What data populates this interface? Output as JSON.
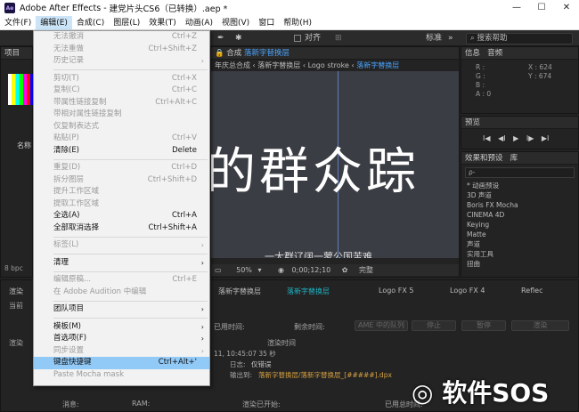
{
  "window": {
    "app": "Adobe After Effects",
    "file": "建党片头CS6（已转换）.aep *",
    "logo": "Ae",
    "min": "—",
    "max": "☐",
    "close": "✕"
  },
  "menubar": [
    "文件(F)",
    "编辑(E)",
    "合成(C)",
    "图层(L)",
    "效果(T)",
    "动画(A)",
    "视图(V)",
    "窗口",
    "帮助(H)"
  ],
  "toolbar": {
    "snap": "对齐",
    "workspace": "标准",
    "search_placeholder": "搜索帮助"
  },
  "project": {
    "title": "项目",
    "name_col": "名称",
    "bpc": "8 bpc"
  },
  "composition": {
    "title": "合成",
    "tab_name": "落新字替换层",
    "breadcrumbs": [
      "字库",
      "年庆总合成",
      "落新字替换层",
      "Logo stroke",
      "落新字替换层"
    ],
    "big_text": "的群众踪",
    "zoom": "50%",
    "timecode": "0;00;12;10",
    "quality": "完整",
    "sub_text": "一大群辽阔一蒙公国苦难"
  },
  "info": {
    "title": "信息",
    "audio": "音频",
    "r": "R :",
    "g": "G :",
    "b": "B :",
    "a": "A : 0",
    "x": "X : 624",
    "y": "Y : 674"
  },
  "preview": {
    "title": "预览",
    "controls": [
      "I◀",
      "◀I",
      "▶",
      "I▶",
      "▶I"
    ]
  },
  "effects": {
    "title": "效果和预设",
    "tab2": "库",
    "search": "ρ-",
    "items": [
      "* 动画预设",
      "3D 声道",
      "Boris FX Mocha",
      "CINEMA 4D",
      "Keying",
      "Matte",
      "声道",
      "实用工具",
      "扭曲"
    ]
  },
  "render_queue": {
    "tabs": [
      "渲染",
      "落新字替换层",
      "落新字替换层",
      "Logo FX 5",
      "Logo FX 4",
      "Reflec"
    ],
    "current": "当前",
    "render_label": "渲染",
    "elapsed": "已用时间:",
    "remaining": "剩余时间:",
    "ame": "AME 中的队列",
    "stop": "停止",
    "pause": "暂停",
    "render": "渲染",
    "status_col": "渲染时间",
    "row_time": "11, 10:45:07    35 秒",
    "log_label": "日志:",
    "log_value": "仅错误",
    "output_label": "输出到:",
    "output_value": "落新字替换层/落新字替换层_[#####].dpx",
    "msg": "消息:",
    "ram": "RAM:",
    "started": "渲染已开始:",
    "total": "已用总时间:"
  },
  "edit_menu": [
    {
      "label": "无法撤消",
      "sc": "Ctrl+Z",
      "dis": true
    },
    {
      "label": "无法重做",
      "sc": "Ctrl+Shift+Z",
      "dis": true
    },
    {
      "label": "历史记录",
      "sc": "",
      "dis": true,
      "sub": true
    },
    {
      "sep": true
    },
    {
      "label": "剪切(T)",
      "sc": "Ctrl+X",
      "dis": true
    },
    {
      "label": "复制(C)",
      "sc": "Ctrl+C",
      "dis": true
    },
    {
      "label": "带属性链接复制",
      "sc": "Ctrl+Alt+C",
      "dis": true
    },
    {
      "label": "带相对属性链接复制",
      "sc": "",
      "dis": true
    },
    {
      "label": "仅复制表达式",
      "sc": "",
      "dis": true
    },
    {
      "label": "粘贴(P)",
      "sc": "Ctrl+V",
      "dis": true
    },
    {
      "label": "清除(E)",
      "sc": "Delete",
      "dis": false
    },
    {
      "sep": true
    },
    {
      "label": "重复(D)",
      "sc": "Ctrl+D",
      "dis": true
    },
    {
      "label": "拆分图层",
      "sc": "Ctrl+Shift+D",
      "dis": true
    },
    {
      "label": "提升工作区域",
      "sc": "",
      "dis": true
    },
    {
      "label": "提取工作区域",
      "sc": "",
      "dis": true
    },
    {
      "label": "全选(A)",
      "sc": "Ctrl+A",
      "dis": false
    },
    {
      "label": "全部取消选择",
      "sc": "Ctrl+Shift+A",
      "dis": false
    },
    {
      "sep": true
    },
    {
      "label": "标签(L)",
      "sc": "",
      "dis": true,
      "sub": true
    },
    {
      "sep": true
    },
    {
      "label": "清理",
      "sc": "",
      "dis": false,
      "sub": true
    },
    {
      "sep": true
    },
    {
      "label": "编辑原稿...",
      "sc": "Ctrl+E",
      "dis": true
    },
    {
      "label": "在 Adobe Audition 中编辑",
      "sc": "",
      "dis": true
    },
    {
      "sep": true
    },
    {
      "label": "团队项目",
      "sc": "",
      "dis": false,
      "sub": true
    },
    {
      "sep": true
    },
    {
      "label": "模板(M)",
      "sc": "",
      "dis": false,
      "sub": true
    },
    {
      "label": "首选项(F)",
      "sc": "",
      "dis": false,
      "sub": true
    },
    {
      "label": "同步设置",
      "sc": "",
      "dis": true,
      "sub": true
    },
    {
      "label": "键盘快捷键",
      "sc": "Ctrl+Alt+'",
      "dis": false,
      "hl": true
    },
    {
      "label": "Paste Mocha mask",
      "sc": "",
      "dis": true
    }
  ],
  "watermark": "软件SOS",
  "colors": {
    "accent": "#4aa3ff",
    "highlight": "#91c9f7",
    "panel": "#232323"
  }
}
